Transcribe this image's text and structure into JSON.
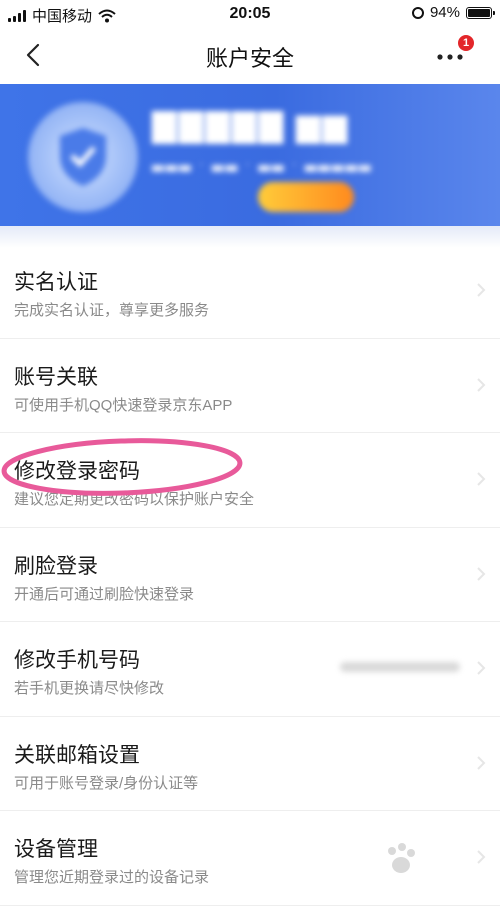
{
  "status_bar": {
    "carrier": "中国移动",
    "time": "20:05",
    "battery": "94%",
    "battery_level": 0.94
  },
  "nav": {
    "title": "账户安全",
    "more_badge": "1"
  },
  "menu": [
    {
      "title": "实名认证",
      "desc": "完成实名认证，尊享更多服务"
    },
    {
      "title": "账号关联",
      "desc": "可使用手机QQ快速登录京东APP"
    },
    {
      "title": "修改登录密码",
      "desc": "建议您定期更改密码以保护账户安全"
    },
    {
      "title": "刷脸登录",
      "desc": "开通后可通过刷脸快速登录"
    },
    {
      "title": "修改手机号码",
      "desc": "若手机更换请尽快修改"
    },
    {
      "title": "关联邮箱设置",
      "desc": "可用于账号登录/身份认证等"
    },
    {
      "title": "设备管理",
      "desc": "管理您近期登录过的设备记录"
    }
  ],
  "colors": {
    "banner": "#3f74e8",
    "highlight": "#e85a9a",
    "badge": "#e3262a"
  },
  "icons": [
    "back-icon",
    "more-icon",
    "wifi-icon",
    "signal-icon",
    "battery-icon",
    "chevron-right-icon"
  ]
}
